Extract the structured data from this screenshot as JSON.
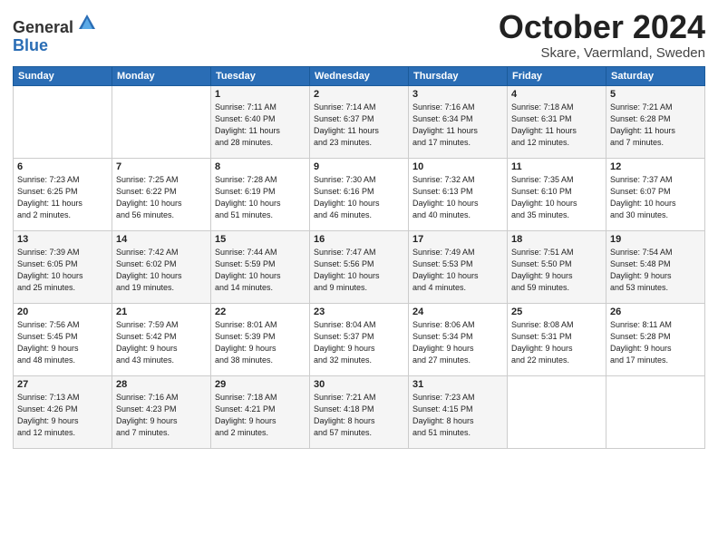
{
  "header": {
    "logo_line1": "General",
    "logo_line2": "Blue",
    "month": "October 2024",
    "location": "Skare, Vaermland, Sweden"
  },
  "weekdays": [
    "Sunday",
    "Monday",
    "Tuesday",
    "Wednesday",
    "Thursday",
    "Friday",
    "Saturday"
  ],
  "weeks": [
    [
      {
        "day": "",
        "info": ""
      },
      {
        "day": "",
        "info": ""
      },
      {
        "day": "1",
        "info": "Sunrise: 7:11 AM\nSunset: 6:40 PM\nDaylight: 11 hours\nand 28 minutes."
      },
      {
        "day": "2",
        "info": "Sunrise: 7:14 AM\nSunset: 6:37 PM\nDaylight: 11 hours\nand 23 minutes."
      },
      {
        "day": "3",
        "info": "Sunrise: 7:16 AM\nSunset: 6:34 PM\nDaylight: 11 hours\nand 17 minutes."
      },
      {
        "day": "4",
        "info": "Sunrise: 7:18 AM\nSunset: 6:31 PM\nDaylight: 11 hours\nand 12 minutes."
      },
      {
        "day": "5",
        "info": "Sunrise: 7:21 AM\nSunset: 6:28 PM\nDaylight: 11 hours\nand 7 minutes."
      }
    ],
    [
      {
        "day": "6",
        "info": "Sunrise: 7:23 AM\nSunset: 6:25 PM\nDaylight: 11 hours\nand 2 minutes."
      },
      {
        "day": "7",
        "info": "Sunrise: 7:25 AM\nSunset: 6:22 PM\nDaylight: 10 hours\nand 56 minutes."
      },
      {
        "day": "8",
        "info": "Sunrise: 7:28 AM\nSunset: 6:19 PM\nDaylight: 10 hours\nand 51 minutes."
      },
      {
        "day": "9",
        "info": "Sunrise: 7:30 AM\nSunset: 6:16 PM\nDaylight: 10 hours\nand 46 minutes."
      },
      {
        "day": "10",
        "info": "Sunrise: 7:32 AM\nSunset: 6:13 PM\nDaylight: 10 hours\nand 40 minutes."
      },
      {
        "day": "11",
        "info": "Sunrise: 7:35 AM\nSunset: 6:10 PM\nDaylight: 10 hours\nand 35 minutes."
      },
      {
        "day": "12",
        "info": "Sunrise: 7:37 AM\nSunset: 6:07 PM\nDaylight: 10 hours\nand 30 minutes."
      }
    ],
    [
      {
        "day": "13",
        "info": "Sunrise: 7:39 AM\nSunset: 6:05 PM\nDaylight: 10 hours\nand 25 minutes."
      },
      {
        "day": "14",
        "info": "Sunrise: 7:42 AM\nSunset: 6:02 PM\nDaylight: 10 hours\nand 19 minutes."
      },
      {
        "day": "15",
        "info": "Sunrise: 7:44 AM\nSunset: 5:59 PM\nDaylight: 10 hours\nand 14 minutes."
      },
      {
        "day": "16",
        "info": "Sunrise: 7:47 AM\nSunset: 5:56 PM\nDaylight: 10 hours\nand 9 minutes."
      },
      {
        "day": "17",
        "info": "Sunrise: 7:49 AM\nSunset: 5:53 PM\nDaylight: 10 hours\nand 4 minutes."
      },
      {
        "day": "18",
        "info": "Sunrise: 7:51 AM\nSunset: 5:50 PM\nDaylight: 9 hours\nand 59 minutes."
      },
      {
        "day": "19",
        "info": "Sunrise: 7:54 AM\nSunset: 5:48 PM\nDaylight: 9 hours\nand 53 minutes."
      }
    ],
    [
      {
        "day": "20",
        "info": "Sunrise: 7:56 AM\nSunset: 5:45 PM\nDaylight: 9 hours\nand 48 minutes."
      },
      {
        "day": "21",
        "info": "Sunrise: 7:59 AM\nSunset: 5:42 PM\nDaylight: 9 hours\nand 43 minutes."
      },
      {
        "day": "22",
        "info": "Sunrise: 8:01 AM\nSunset: 5:39 PM\nDaylight: 9 hours\nand 38 minutes."
      },
      {
        "day": "23",
        "info": "Sunrise: 8:04 AM\nSunset: 5:37 PM\nDaylight: 9 hours\nand 32 minutes."
      },
      {
        "day": "24",
        "info": "Sunrise: 8:06 AM\nSunset: 5:34 PM\nDaylight: 9 hours\nand 27 minutes."
      },
      {
        "day": "25",
        "info": "Sunrise: 8:08 AM\nSunset: 5:31 PM\nDaylight: 9 hours\nand 22 minutes."
      },
      {
        "day": "26",
        "info": "Sunrise: 8:11 AM\nSunset: 5:28 PM\nDaylight: 9 hours\nand 17 minutes."
      }
    ],
    [
      {
        "day": "27",
        "info": "Sunrise: 7:13 AM\nSunset: 4:26 PM\nDaylight: 9 hours\nand 12 minutes."
      },
      {
        "day": "28",
        "info": "Sunrise: 7:16 AM\nSunset: 4:23 PM\nDaylight: 9 hours\nand 7 minutes."
      },
      {
        "day": "29",
        "info": "Sunrise: 7:18 AM\nSunset: 4:21 PM\nDaylight: 9 hours\nand 2 minutes."
      },
      {
        "day": "30",
        "info": "Sunrise: 7:21 AM\nSunset: 4:18 PM\nDaylight: 8 hours\nand 57 minutes."
      },
      {
        "day": "31",
        "info": "Sunrise: 7:23 AM\nSunset: 4:15 PM\nDaylight: 8 hours\nand 51 minutes."
      },
      {
        "day": "",
        "info": ""
      },
      {
        "day": "",
        "info": ""
      }
    ]
  ]
}
